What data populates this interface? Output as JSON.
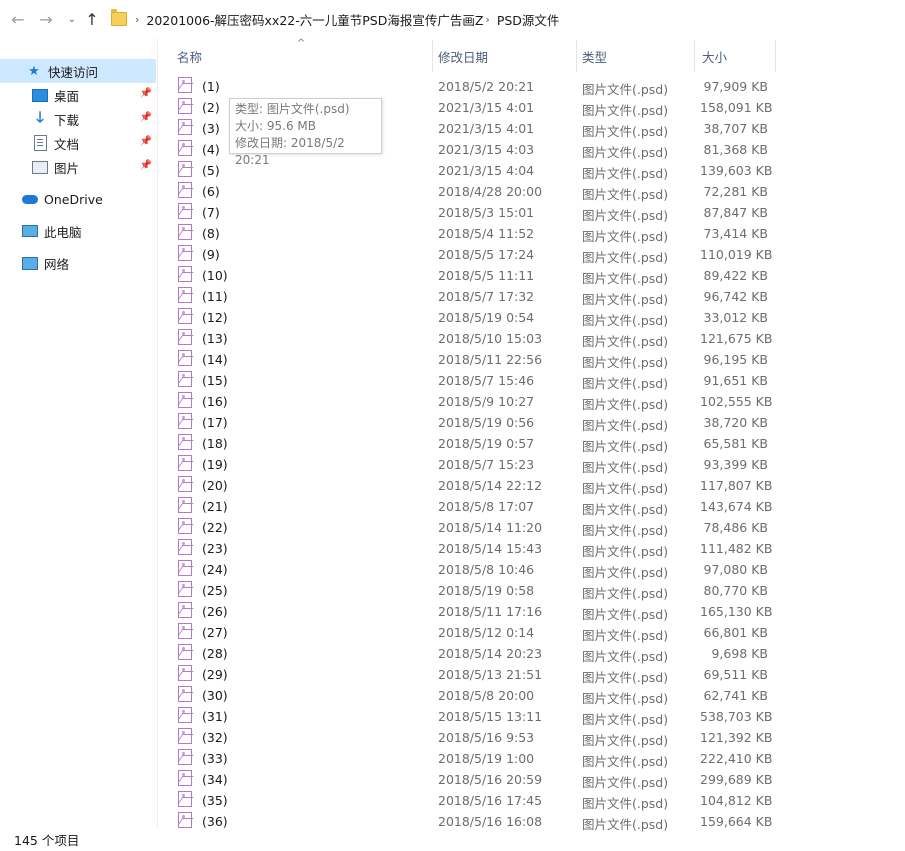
{
  "nav": {
    "back": "←",
    "forward": "→",
    "recent": "⌄",
    "up": "↑"
  },
  "address": {
    "sep": "›",
    "crumbs": [
      "20201006-解压密码xx22-六一儿童节PSD海报宣传广告画Z",
      "PSD源文件"
    ]
  },
  "sidebar": {
    "quick_access": "快速访问",
    "desktop": "桌面",
    "downloads": "下载",
    "documents": "文档",
    "pictures": "图片",
    "onedrive": "OneDrive",
    "this_pc": "此电脑",
    "network": "网络"
  },
  "columns": {
    "name": "名称",
    "date": "修改日期",
    "type": "类型",
    "size": "大小",
    "sort_arrow": "^"
  },
  "tooltip": {
    "type": "类型: 图片文件(.psd)",
    "size": "大小: 95.6 MB",
    "date": "修改日期: 2018/5/2 20:21"
  },
  "files": [
    {
      "name": "(1)",
      "date": "2018/5/2 20:21",
      "type": "图片文件(.psd)",
      "size": "97,909 KB"
    },
    {
      "name": "(2)",
      "date": "2021/3/15 4:01",
      "type": "图片文件(.psd)",
      "size": "158,091 KB"
    },
    {
      "name": "(3)",
      "date": "2021/3/15 4:01",
      "type": "图片文件(.psd)",
      "size": "38,707 KB"
    },
    {
      "name": "(4)",
      "date": "2021/3/15 4:03",
      "type": "图片文件(.psd)",
      "size": "81,368 KB"
    },
    {
      "name": "(5)",
      "date": "2021/3/15 4:04",
      "type": "图片文件(.psd)",
      "size": "139,603 KB"
    },
    {
      "name": "(6)",
      "date": "2018/4/28 20:00",
      "type": "图片文件(.psd)",
      "size": "72,281 KB"
    },
    {
      "name": "(7)",
      "date": "2018/5/3 15:01",
      "type": "图片文件(.psd)",
      "size": "87,847 KB"
    },
    {
      "name": "(8)",
      "date": "2018/5/4 11:52",
      "type": "图片文件(.psd)",
      "size": "73,414 KB"
    },
    {
      "name": "(9)",
      "date": "2018/5/5 17:24",
      "type": "图片文件(.psd)",
      "size": "110,019 KB"
    },
    {
      "name": "(10)",
      "date": "2018/5/5 11:11",
      "type": "图片文件(.psd)",
      "size": "89,422 KB"
    },
    {
      "name": "(11)",
      "date": "2018/5/7 17:32",
      "type": "图片文件(.psd)",
      "size": "96,742 KB"
    },
    {
      "name": "(12)",
      "date": "2018/5/19 0:54",
      "type": "图片文件(.psd)",
      "size": "33,012 KB"
    },
    {
      "name": "(13)",
      "date": "2018/5/10 15:03",
      "type": "图片文件(.psd)",
      "size": "121,675 KB"
    },
    {
      "name": "(14)",
      "date": "2018/5/11 22:56",
      "type": "图片文件(.psd)",
      "size": "96,195 KB"
    },
    {
      "name": "(15)",
      "date": "2018/5/7 15:46",
      "type": "图片文件(.psd)",
      "size": "91,651 KB"
    },
    {
      "name": "(16)",
      "date": "2018/5/9 10:27",
      "type": "图片文件(.psd)",
      "size": "102,555 KB"
    },
    {
      "name": "(17)",
      "date": "2018/5/19 0:56",
      "type": "图片文件(.psd)",
      "size": "38,720 KB"
    },
    {
      "name": "(18)",
      "date": "2018/5/19 0:57",
      "type": "图片文件(.psd)",
      "size": "65,581 KB"
    },
    {
      "name": "(19)",
      "date": "2018/5/7 15:23",
      "type": "图片文件(.psd)",
      "size": "93,399 KB"
    },
    {
      "name": "(20)",
      "date": "2018/5/14 22:12",
      "type": "图片文件(.psd)",
      "size": "117,807 KB"
    },
    {
      "name": "(21)",
      "date": "2018/5/8 17:07",
      "type": "图片文件(.psd)",
      "size": "143,674 KB"
    },
    {
      "name": "(22)",
      "date": "2018/5/14 11:20",
      "type": "图片文件(.psd)",
      "size": "78,486 KB"
    },
    {
      "name": "(23)",
      "date": "2018/5/14 15:43",
      "type": "图片文件(.psd)",
      "size": "111,482 KB"
    },
    {
      "name": "(24)",
      "date": "2018/5/8 10:46",
      "type": "图片文件(.psd)",
      "size": "97,080 KB"
    },
    {
      "name": "(25)",
      "date": "2018/5/19 0:58",
      "type": "图片文件(.psd)",
      "size": "80,770 KB"
    },
    {
      "name": "(26)",
      "date": "2018/5/11 17:16",
      "type": "图片文件(.psd)",
      "size": "165,130 KB"
    },
    {
      "name": "(27)",
      "date": "2018/5/12 0:14",
      "type": "图片文件(.psd)",
      "size": "66,801 KB"
    },
    {
      "name": "(28)",
      "date": "2018/5/14 20:23",
      "type": "图片文件(.psd)",
      "size": "9,698 KB"
    },
    {
      "name": "(29)",
      "date": "2018/5/13 21:51",
      "type": "图片文件(.psd)",
      "size": "69,511 KB"
    },
    {
      "name": "(30)",
      "date": "2018/5/8 20:00",
      "type": "图片文件(.psd)",
      "size": "62,741 KB"
    },
    {
      "name": "(31)",
      "date": "2018/5/15 13:11",
      "type": "图片文件(.psd)",
      "size": "538,703 KB"
    },
    {
      "name": "(32)",
      "date": "2018/5/16 9:53",
      "type": "图片文件(.psd)",
      "size": "121,392 KB"
    },
    {
      "name": "(33)",
      "date": "2018/5/19 1:00",
      "type": "图片文件(.psd)",
      "size": "222,410 KB"
    },
    {
      "name": "(34)",
      "date": "2018/5/16 20:59",
      "type": "图片文件(.psd)",
      "size": "299,689 KB"
    },
    {
      "name": "(35)",
      "date": "2018/5/16 17:45",
      "type": "图片文件(.psd)",
      "size": "104,812 KB"
    },
    {
      "name": "(36)",
      "date": "2018/5/16 16:08",
      "type": "图片文件(.psd)",
      "size": "159,664 KB"
    }
  ],
  "status": {
    "count": "145 个项目"
  }
}
